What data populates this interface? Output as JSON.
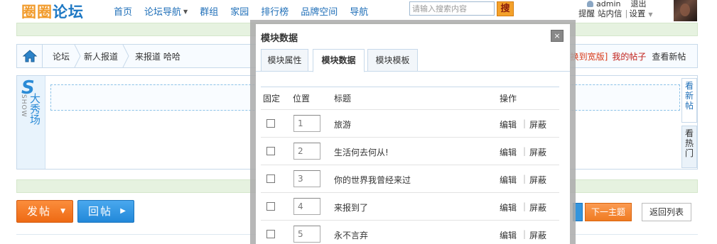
{
  "topnav": {
    "logo_part1": "圈圈",
    "logo_part2": "论坛",
    "items": [
      {
        "label": "首页"
      },
      {
        "label": "论坛导航",
        "has_dropdown": true
      },
      {
        "label": "群组"
      },
      {
        "label": "家园"
      },
      {
        "label": "排行榜"
      },
      {
        "label": "品牌空间"
      },
      {
        "label": "导航"
      }
    ],
    "search_placeholder": "请输入搜索内容",
    "search_button": "搜",
    "user": "admin",
    "logout": "退出",
    "links": [
      "提醒",
      "站内信",
      "设置"
    ]
  },
  "breadcrumb": {
    "items": [
      "论坛",
      "新人报道",
      "来报道 哈哈"
    ],
    "widen": "[换到宽版]",
    "my_posts": "我的帖子",
    "newest": "查看新帖"
  },
  "show_panel": {
    "s_letter": "S",
    "show_word": "SHOW",
    "title_cn": "大秀场",
    "side_tabs": [
      "看新帖",
      "看热门"
    ]
  },
  "actions": {
    "post": "发帖",
    "reply": "回帖",
    "next_topic": "下一主题",
    "back_to_list": "返回列表"
  },
  "modal": {
    "title": "模块数据",
    "close": "×",
    "tabs": [
      {
        "label": "模块属性",
        "active": false
      },
      {
        "label": "模块数据",
        "active": true
      },
      {
        "label": "模块模板",
        "active": false
      }
    ],
    "columns": {
      "fixed": "固定",
      "position": "位置",
      "title": "标题",
      "ops": "操作"
    },
    "rows": [
      {
        "position": "1",
        "title": "旅游",
        "checked": false
      },
      {
        "position": "2",
        "title": "生活何去何从!",
        "checked": false
      },
      {
        "position": "3",
        "title": "你的世界我曾经来过",
        "checked": false
      },
      {
        "position": "4",
        "title": "来报到了",
        "checked": false
      },
      {
        "position": "5",
        "title": "永不言弃",
        "checked": false
      }
    ],
    "edit_label": "编辑",
    "block_label": "屏蔽",
    "sep": "|"
  },
  "colors": {
    "brand_orange": "#f19a2a",
    "brand_blue": "#1f79c4",
    "nav_link": "#1f6fb8",
    "accent_red": "#c0201a"
  }
}
